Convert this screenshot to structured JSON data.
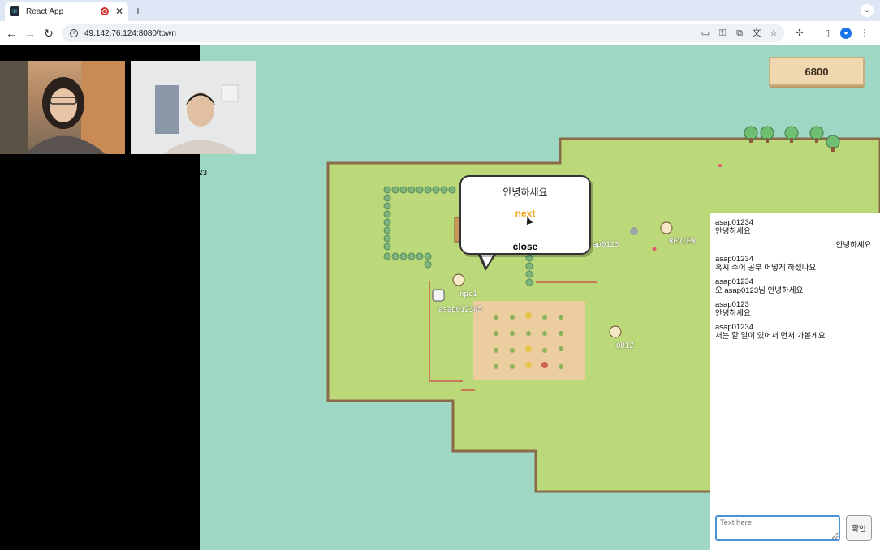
{
  "browser": {
    "tab_title": "React App",
    "url": "49.142.76.124:8080/town"
  },
  "game": {
    "score": "6800",
    "stray_text": "23",
    "labels": {
      "npc": "npc1",
      "player1": "asap012345",
      "player2": "ap0123",
      "review": "REVIEW",
      "quiz": "QUIZ"
    },
    "dialog": {
      "title": "안녕하세요",
      "next": "next",
      "close": "close"
    }
  },
  "chat": {
    "messages": [
      {
        "user": "asap01234",
        "text": "안녕하세요",
        "align": "left"
      },
      {
        "user": "",
        "text": "안녕하세요.",
        "align": "right"
      },
      {
        "user": "asap01234",
        "text": "혹시 수어 공부 어떻게 하셨나요",
        "align": "left"
      },
      {
        "user": "asap01234",
        "text": "오 asap0123님 안녕하세요",
        "align": "left"
      },
      {
        "user": "asap0123",
        "text": "안녕하세요",
        "align": "left"
      },
      {
        "user": "asap01234",
        "text": "저는 할 일이 있어서 먼저 가볼게요",
        "align": "left"
      }
    ],
    "input_placeholder": "Text here!",
    "send_label": "확인"
  }
}
